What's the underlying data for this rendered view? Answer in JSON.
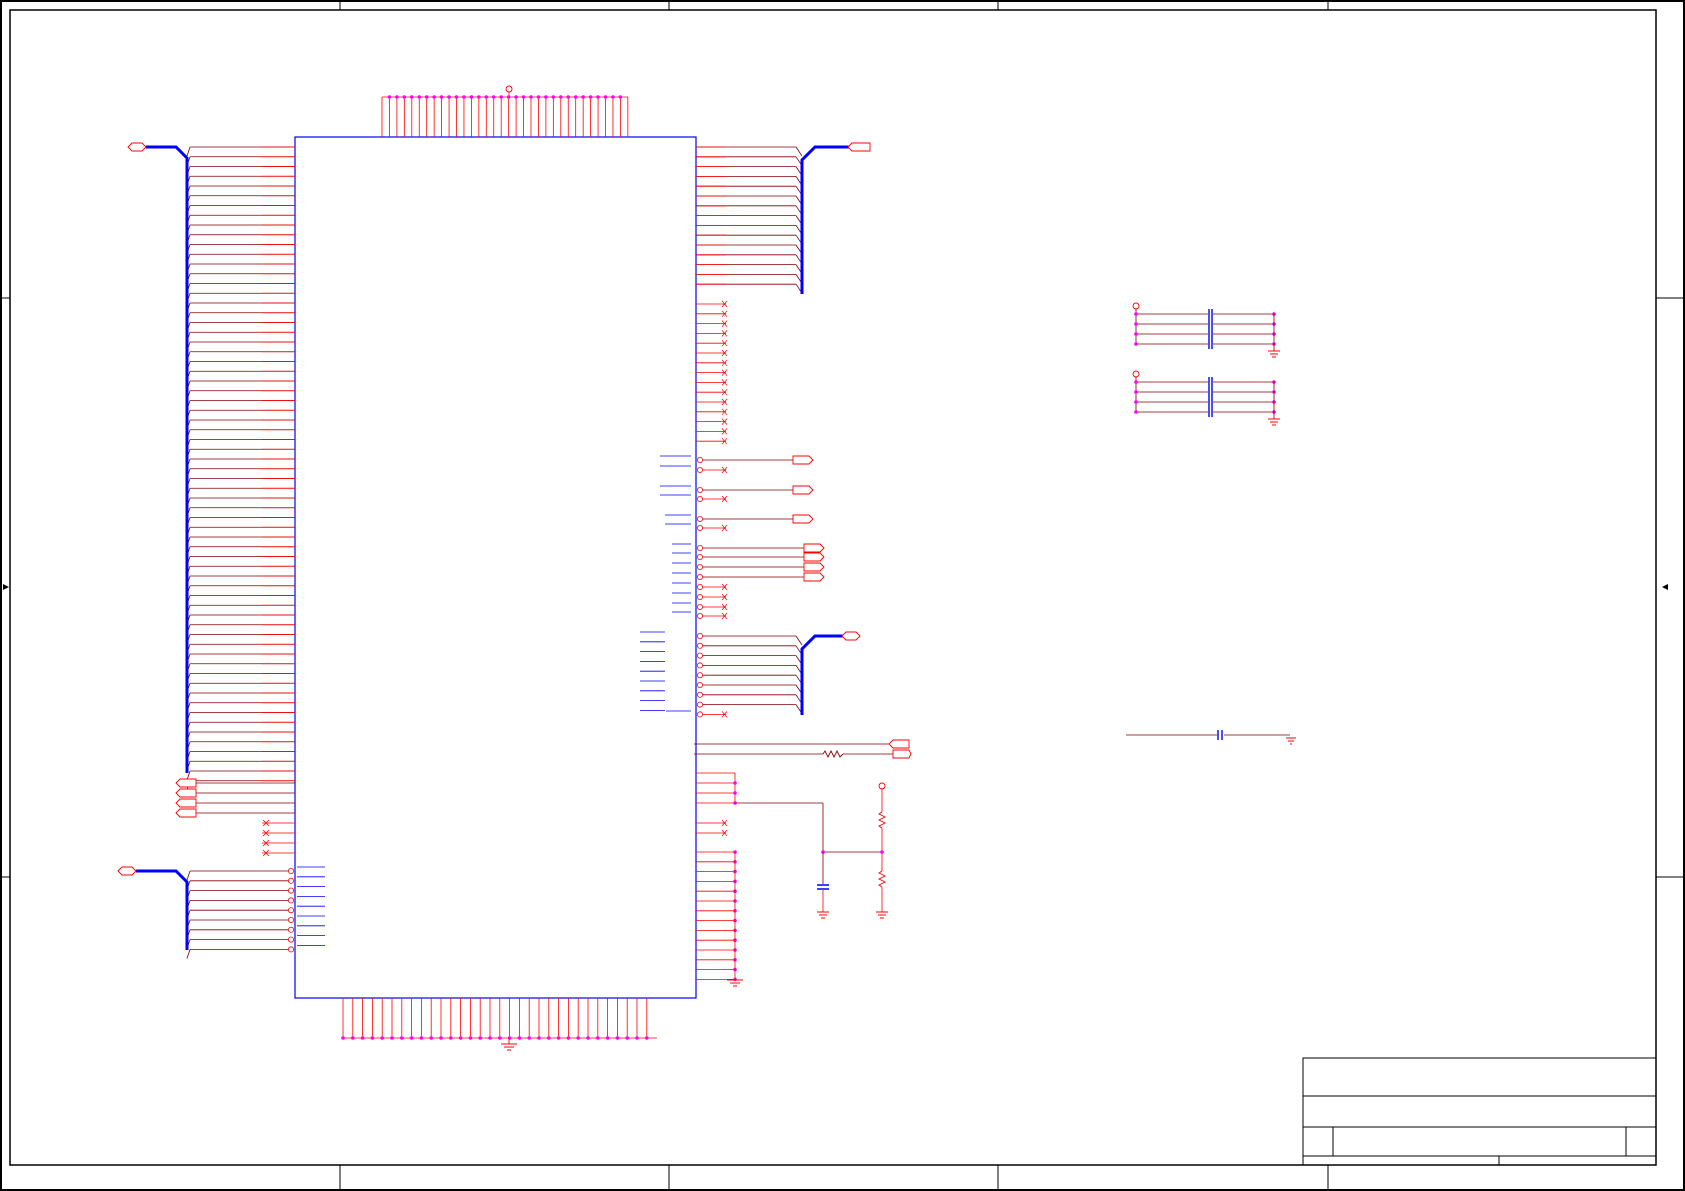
{
  "sheet": {
    "title_block": {
      "title": "",
      "doc_number": "",
      "revision": "",
      "size": "",
      "date": "",
      "sheet_of": ""
    }
  },
  "colors": {
    "border": "#000000",
    "pin": "#ff0000",
    "wire": "#800000",
    "bus": "#0000ff",
    "component_body": "#0000ff",
    "junction": "#ff00ff",
    "capacitor": "#0000ff"
  },
  "components": {
    "main_ic": "ic-body",
    "capacitor_bank_1": "capacitor-bank",
    "capacitor_bank_2": "capacitor-bank",
    "single_capacitor": "capacitor",
    "series_resistor": "resistor",
    "voltage_divider": "resistor-divider"
  }
}
